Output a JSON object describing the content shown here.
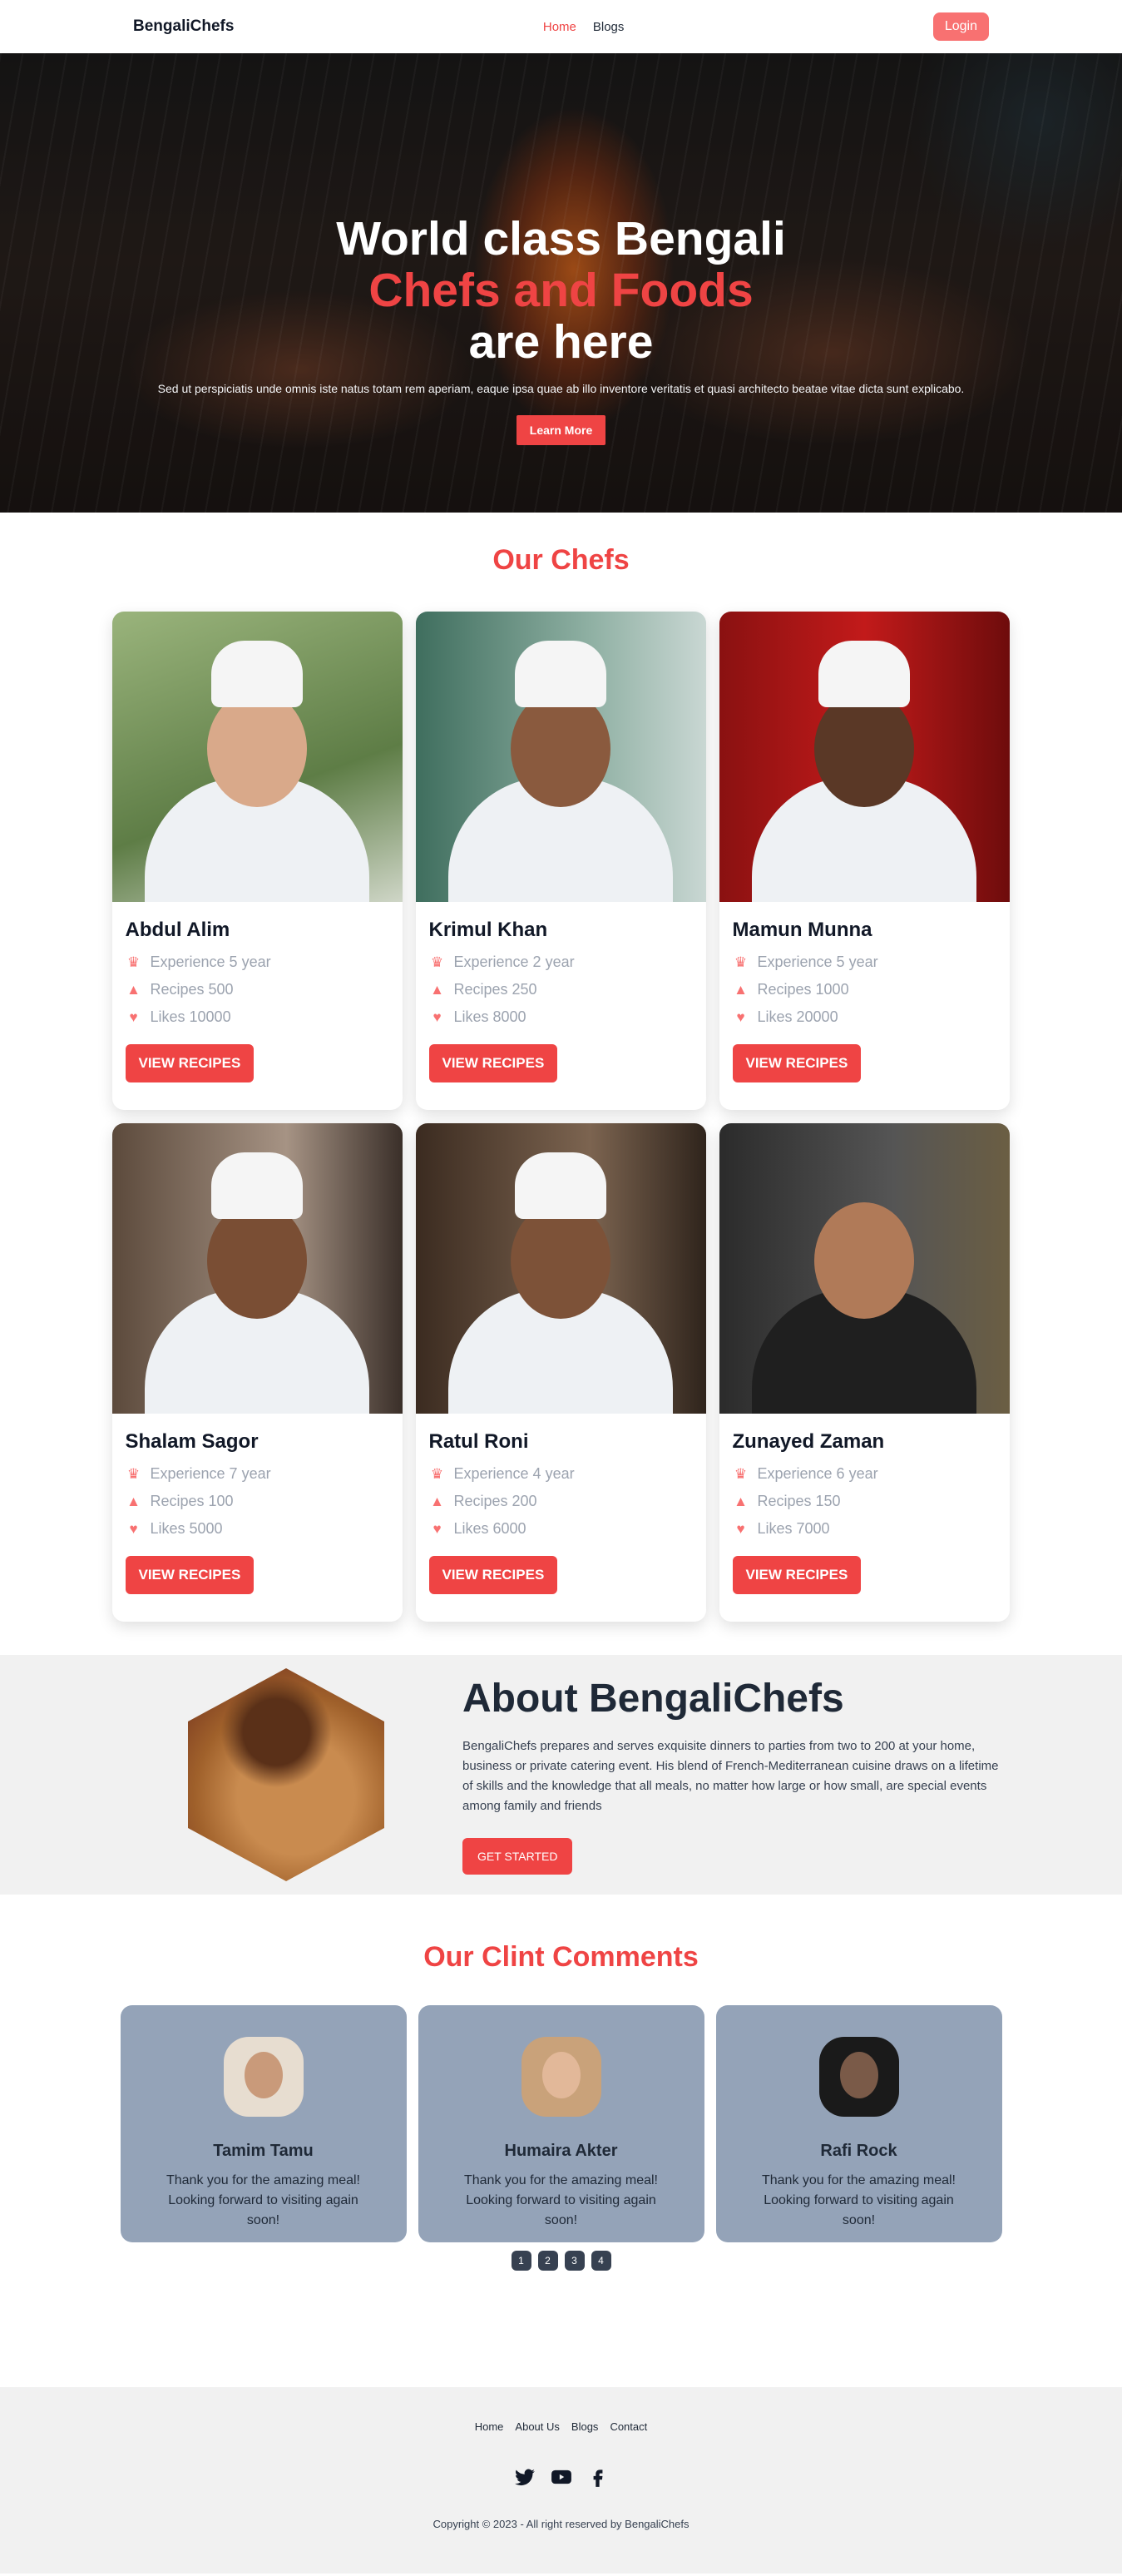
{
  "nav": {
    "brand": "BengaliChefs",
    "links": [
      "Home",
      "Blogs"
    ],
    "login": "Login"
  },
  "hero": {
    "title_line1": "World class Bengali",
    "title_line2": "Chefs and Foods",
    "title_line3": "are here",
    "description": "Sed ut perspiciatis unde omnis iste natus totam rem aperiam, eaque ipsa quae ab illo inventore veritatis et quasi architecto beatae vitae dicta sunt explicabo.",
    "button": "Learn More"
  },
  "chefs": {
    "title": "Our Chefs",
    "button": "VIEW RECIPES",
    "items": [
      {
        "name": "Abdul Alim",
        "experience": "Experience 5 year",
        "recipes": "Recipes 500",
        "likes": "Likes 10000"
      },
      {
        "name": "Krimul Khan",
        "experience": "Experience 2 year",
        "recipes": "Recipes 250",
        "likes": "Likes 8000"
      },
      {
        "name": "Mamun Munna",
        "experience": "Experience 5 year",
        "recipes": "Recipes 1000",
        "likes": "Likes 20000"
      },
      {
        "name": "Shalam Sagor",
        "experience": "Experience 7 year",
        "recipes": "Recipes 100",
        "likes": "Likes 5000"
      },
      {
        "name": "Ratul Roni",
        "experience": "Experience 4 year",
        "recipes": "Recipes 200",
        "likes": "Likes 6000"
      },
      {
        "name": "Zunayed Zaman",
        "experience": "Experience 6 year",
        "recipes": "Recipes 150",
        "likes": "Likes 7000"
      }
    ]
  },
  "about": {
    "title": "About BengaliChefs",
    "text": "BengaliChefs prepares and serves exquisite dinners to parties from two to 200 at your home, business or private catering event. His blend of French-Mediterranean cuisine draws on a lifetime of skills and the knowledge that all meals, no matter how large or how small, are special events among family and friends",
    "button": "GET STARTED"
  },
  "comments": {
    "title": "Our Clint Comments",
    "items": [
      {
        "name": "Tamim Tamu",
        "text": "Thank you for the amazing meal! Looking forward to visiting again soon!"
      },
      {
        "name": "Humaira Akter",
        "text": "Thank you for the amazing meal! Looking forward to visiting again soon!"
      },
      {
        "name": "Rafi Rock",
        "text": "Thank you for the amazing meal! Looking forward to visiting again soon!"
      }
    ],
    "pages": [
      "1",
      "2",
      "3",
      "4"
    ]
  },
  "footer": {
    "links": [
      "Home",
      "About Us",
      "Blogs",
      "Contact"
    ],
    "copyright": "Copyright © 2023 - All right reserved by BengaliChefs"
  },
  "icons": {
    "experience": "crown-icon",
    "recipes": "chef-hat-icon",
    "likes": "heart-icon",
    "socials": [
      "twitter-icon",
      "youtube-icon",
      "facebook-icon"
    ]
  },
  "colors": {
    "accent": "#ef4444",
    "card_bg": "#94a3b8",
    "section_bg": "#f1f1f1"
  }
}
